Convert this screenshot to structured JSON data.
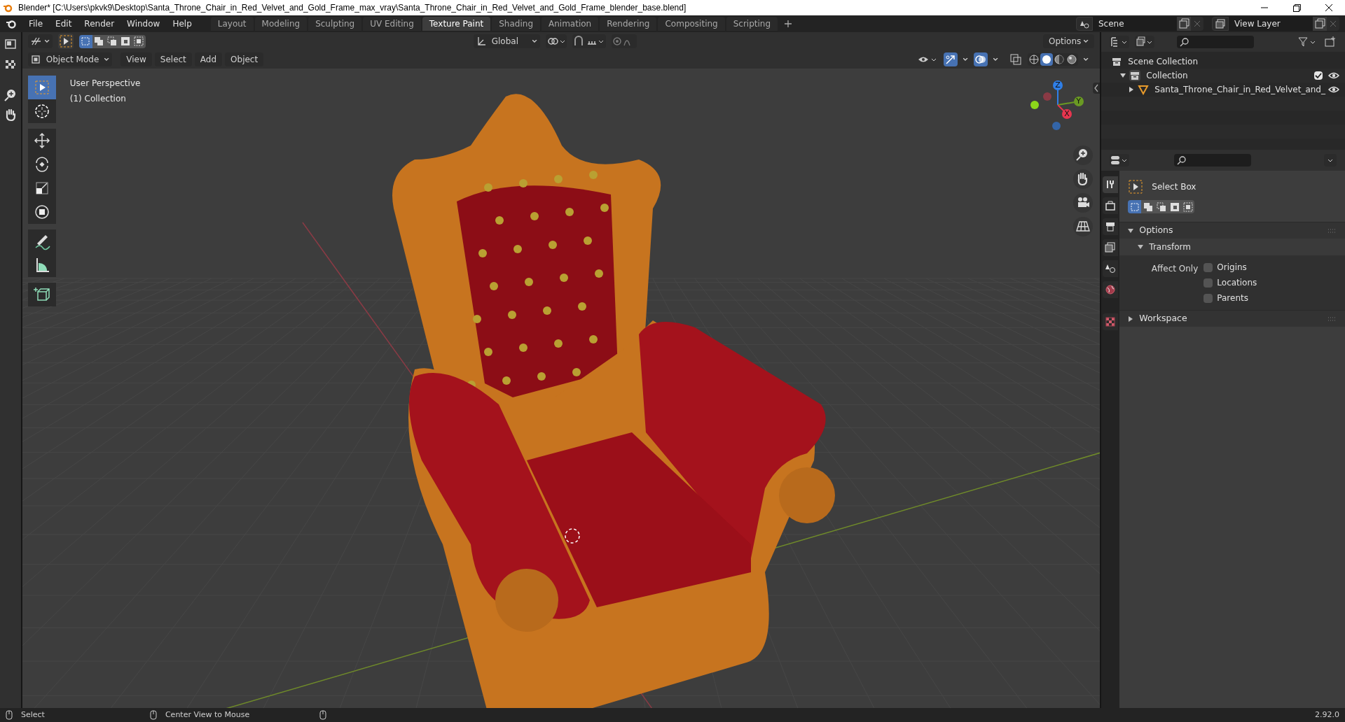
{
  "window": {
    "title": "Blender* [C:\\Users\\pkvk9\\Desktop\\Santa_Throne_Chair_in_Red_Velvet_and_Gold_Frame_max_vray\\Santa_Throne_Chair_in_Red_Velvet_and_Gold_Frame_blender_base.blend]"
  },
  "menu": [
    "File",
    "Edit",
    "Render",
    "Window",
    "Help"
  ],
  "workspace_tabs": [
    {
      "label": "Layout",
      "selected": false
    },
    {
      "label": "Modeling",
      "selected": false
    },
    {
      "label": "Sculpting",
      "selected": false
    },
    {
      "label": "UV Editing",
      "selected": false
    },
    {
      "label": "Texture Paint",
      "selected": true
    },
    {
      "label": "Shading",
      "selected": false
    },
    {
      "label": "Animation",
      "selected": false
    },
    {
      "label": "Rendering",
      "selected": false
    },
    {
      "label": "Compositing",
      "selected": false
    },
    {
      "label": "Scripting",
      "selected": false
    }
  ],
  "scene": "Scene",
  "view_layer": "View Layer",
  "tool_header": {
    "select_modes": [
      {
        "selected": true
      },
      {
        "selected": false
      },
      {
        "selected": false
      },
      {
        "selected": false
      },
      {
        "selected": false
      }
    ],
    "orientation": "Global",
    "options": "Options"
  },
  "viewport_header": {
    "mode": "Object Mode",
    "menus": [
      "View",
      "Select",
      "Add",
      "Object"
    ]
  },
  "viewport": {
    "overlay_lines": [
      "User Perspective",
      "(1) Collection"
    ],
    "gizmo_axes": [
      {
        "label": "Z",
        "color": "#2f7fe8"
      },
      {
        "label": "Y",
        "color": "#6a9a23"
      },
      {
        "label": "X",
        "color": "#e8354f"
      }
    ]
  },
  "tools": [
    {
      "kind": "select",
      "selected": true
    },
    {
      "kind": "cursor",
      "selected": false
    },
    {
      "kind": "move",
      "selected": false
    },
    {
      "kind": "rotate",
      "selected": false
    },
    {
      "kind": "scale",
      "selected": false
    },
    {
      "kind": "transform",
      "selected": false
    },
    {
      "kind": "annotate",
      "selected": false
    },
    {
      "kind": "measure",
      "selected": false
    },
    {
      "kind": "add",
      "selected": false
    }
  ],
  "outliner": {
    "items": [
      {
        "label": "Scene Collection",
        "kind": "scene",
        "children": [
          {
            "label": "Collection",
            "kind": "collection",
            "expanded": true,
            "checked": true,
            "visible": true,
            "children": [
              {
                "label": "Santa_Throne_Chair_in_Red_Velvet_and_",
                "kind": "mesh",
                "expanded": false,
                "visible": true
              }
            ]
          }
        ]
      }
    ]
  },
  "properties": {
    "tabs": [
      {
        "kind": "tool",
        "selected": true
      },
      {
        "kind": "render",
        "selected": false
      },
      {
        "kind": "output",
        "selected": false
      },
      {
        "kind": "view_layer",
        "selected": false
      },
      {
        "kind": "scene",
        "selected": false
      },
      {
        "kind": "world",
        "selected": false
      },
      {
        "kind": "texture",
        "selected": false
      }
    ],
    "tool_name": "Select Box",
    "mode_buttons": [
      {
        "selected": true
      },
      {
        "selected": false
      },
      {
        "selected": false
      },
      {
        "selected": false
      },
      {
        "selected": false
      }
    ],
    "panels": [
      {
        "title": "Options",
        "expanded": true,
        "subpanels": [
          {
            "title": "Transform",
            "expanded": true,
            "label": "Affect Only",
            "checkboxes": [
              {
                "label": "Origins",
                "checked": false
              },
              {
                "label": "Locations",
                "checked": false
              },
              {
                "label": "Parents",
                "checked": false
              }
            ]
          }
        ]
      },
      {
        "title": "Workspace",
        "expanded": false
      }
    ]
  },
  "status_bar": {
    "items": [
      "Select",
      "Center View to Mouse"
    ],
    "version": "2.92.0"
  }
}
